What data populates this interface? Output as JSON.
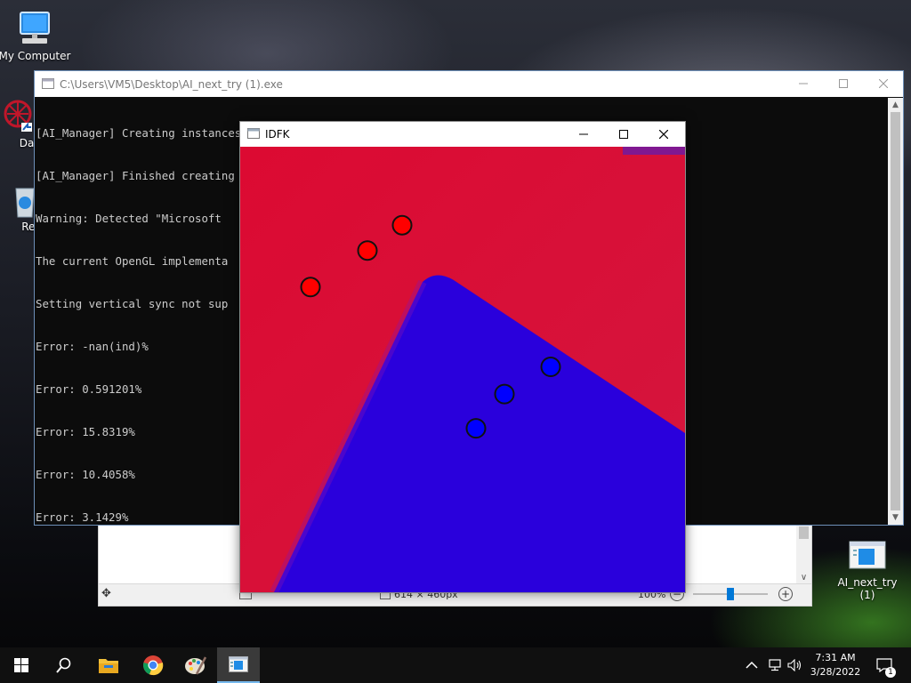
{
  "desktop": {
    "icons": [
      {
        "label": "My Computer",
        "icon": "computer-icon"
      },
      {
        "label": "DataW",
        "icon": "datawarrior-icon"
      },
      {
        "label": "Recyc",
        "icon": "recycle-bin-icon"
      },
      {
        "label": "AI_next_try\n(1)",
        "icon": "exe-icon"
      }
    ]
  },
  "console": {
    "title": "C:\\Users\\VM5\\Desktop\\AI_next_try (1).exe",
    "lines": [
      "[AI_Manager] Creating instances...",
      "[AI_Manager] Finished creating Instances",
      "Warning: Detected \"Microsoft",
      "The current OpenGL implementa",
      "Setting vertical sync not sup",
      "Error: -nan(ind)%",
      "Error: 0.591201%",
      "Error: 15.8319%",
      "Error: 10.4058%",
      "Error: 3.1429%"
    ]
  },
  "viewer": {
    "dimensions": "614 × 460px",
    "zoom": "100%"
  },
  "idfk": {
    "title": "IDFK",
    "colors": {
      "red": "#dc0a32",
      "blue": "#2a00dc",
      "red_point": "#ff0000",
      "blue_point": "#0000ff"
    },
    "points": [
      {
        "cls": "red",
        "x": 0.158,
        "y": 0.315
      },
      {
        "cls": "red",
        "x": 0.286,
        "y": 0.233
      },
      {
        "cls": "red",
        "x": 0.364,
        "y": 0.176
      },
      {
        "cls": "blue",
        "x": 0.53,
        "y": 0.632
      },
      {
        "cls": "blue",
        "x": 0.594,
        "y": 0.555
      },
      {
        "cls": "blue",
        "x": 0.698,
        "y": 0.494
      }
    ]
  },
  "taskbar": {
    "items": [
      {
        "name": "start-button",
        "icon": "windows-icon"
      },
      {
        "name": "search-button",
        "icon": "search-icon"
      },
      {
        "name": "file-explorer-button",
        "icon": "folder-icon"
      },
      {
        "name": "chrome-button",
        "icon": "chrome-icon"
      },
      {
        "name": "paint-button",
        "icon": "paint-icon"
      },
      {
        "name": "console-app-button",
        "icon": "console-app-icon"
      }
    ],
    "time": "7:31 AM",
    "date": "3/28/2022",
    "notifications": "1"
  }
}
